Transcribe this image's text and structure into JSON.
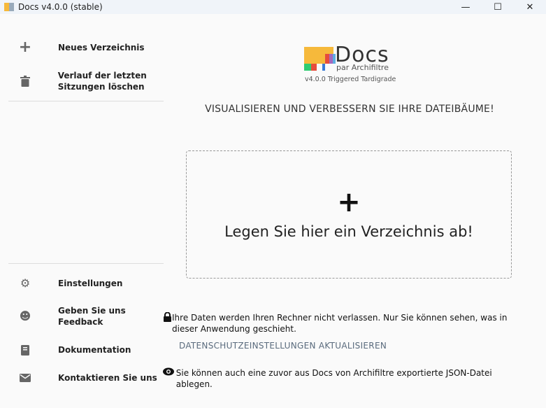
{
  "window": {
    "title": "Docs v4.0.0 (stable)",
    "minimize": "—",
    "maximize": "☐",
    "close": "✕"
  },
  "sidebar": {
    "top": [
      {
        "label": "Neues Verzeichnis",
        "icon": "plus-icon"
      },
      {
        "label": "Verlauf der letzten Sitzungen löschen",
        "icon": "trash-icon"
      }
    ],
    "bottom": [
      {
        "label": "Einstellungen",
        "icon": "gear-icon"
      },
      {
        "label": "Geben Sie uns Feedback",
        "icon": "smiley-icon"
      },
      {
        "label": "Dokumentation",
        "icon": "book-icon"
      },
      {
        "label": "Kontaktieren Sie uns",
        "icon": "mail-icon"
      }
    ]
  },
  "logo": {
    "name": "Docs",
    "subtitle": "par Archifiltre",
    "version": "v4.0.0 Triggered Tardigrade"
  },
  "main": {
    "tagline": "VISUALISIEREN UND VERBESSERN SIE IHRE DATEIBÄUME!",
    "drop_plus": "+",
    "drop_text": "Legen Sie hier ein Verzeichnis ab!",
    "privacy_note": "Ihre Daten werden Ihren Rechner nicht verlassen. Nur Sie können sehen, was in dieser Anwendung geschieht.",
    "privacy_link": "DATENSCHUTZEINSTELLUNGEN AKTUALISIEREN",
    "json_note": "Sie können auch eine zuvor aus Docs von Archifiltre exportierte JSON-Datei ablegen."
  }
}
